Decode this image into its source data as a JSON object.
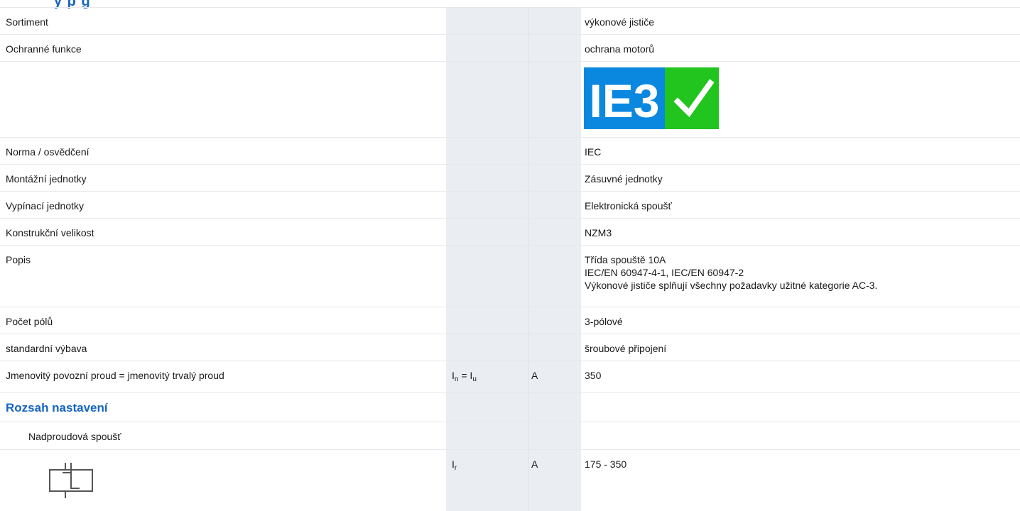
{
  "header": {
    "title_fragment": "y p g"
  },
  "rows": [
    {
      "label": "Sortiment",
      "value": "výkonové jističe"
    },
    {
      "label": "Ochranné funkce",
      "value": "ochrana motorů"
    },
    {
      "label": "",
      "value": "",
      "badge": {
        "text": "IE3",
        "check": "checkmark-icon",
        "left_color": "#0a88e0",
        "right_color": "#22c41e"
      }
    },
    {
      "label": "Norma / osvědčení",
      "value": "IEC"
    },
    {
      "label": "Montážní jednotky",
      "value": "Zásuvné jednotky"
    },
    {
      "label": "Vypínací jednotky",
      "value": "Elektronická spoušť"
    },
    {
      "label": "Konstrukční velikost",
      "value": "NZM3"
    },
    {
      "label": "Popis",
      "value_lines": [
        "Třída spouště 10A",
        "IEC/EN 60947-4-1, IEC/EN 60947-2",
        "Výkonové jističe splňují všechny požadavky užitné kategorie AC-3."
      ]
    },
    {
      "label": "Počet pólů",
      "value": "3-pólové"
    },
    {
      "label": "standardní výbava",
      "value": "šroubové připojení"
    },
    {
      "label": "Jmenovitý povozní proud = jmenovitý trvalý proud",
      "symbol": {
        "a": "I",
        "a_sub": "n",
        "eq": " = ",
        "b": "I",
        "b_sub": "u"
      },
      "unit": "A",
      "value": "350"
    },
    {
      "section": "Rozsah nastavení"
    },
    {
      "sublabel": "Nadproudová spoušť"
    },
    {
      "icon": "overcurrent-release-icon",
      "symbol": {
        "a": "I",
        "a_sub": "r"
      },
      "unit": "A",
      "value": "175 - 350"
    }
  ],
  "colors": {
    "accent": "#1565c0",
    "column_shade": "#eaedf1",
    "row_border": "#e6e8eb"
  }
}
